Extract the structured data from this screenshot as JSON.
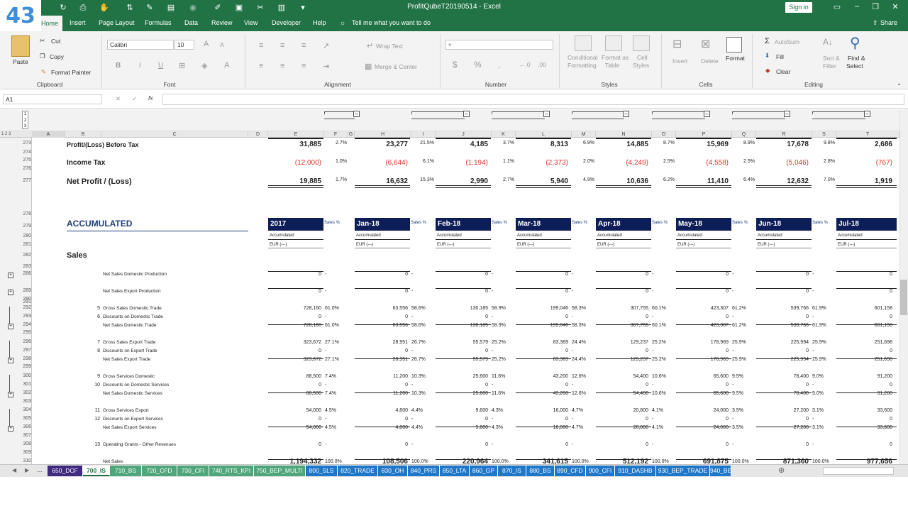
{
  "badge": "43",
  "title": "ProfitQubeT20190514  -  Excel",
  "signin": "Sign in",
  "ribbon_tabs": [
    "Home",
    "Insert",
    "Page Layout",
    "Formulas",
    "Data",
    "Review",
    "View",
    "Developer",
    "Help"
  ],
  "tellme": "Tell me what you want to do",
  "share": "Share",
  "clipboard": {
    "paste": "Paste",
    "cut": "Cut",
    "copy": "Copy",
    "format_painter": "Format Painter",
    "label": "Clipboard"
  },
  "font": {
    "name": "Calibri",
    "size": "10",
    "label": "Font",
    "b": "B",
    "i": "I",
    "u": "U"
  },
  "alignment": {
    "wrap": "Wrap Text",
    "merge": "Merge & Center",
    "label": "Alignment"
  },
  "number": {
    "label": "Number",
    "currency": "$",
    "percent": "%",
    "comma": ","
  },
  "styles": {
    "cond": "Conditional",
    "cond2": "Formatting",
    "fmt_as": "Format as",
    "fmt_as2": "Table",
    "cell": "Cell",
    "cell2": "Styles",
    "label": "Styles"
  },
  "cells": {
    "insert": "Insert",
    "delete": "Delete",
    "format": "Format",
    "label": "Cells"
  },
  "editing": {
    "autosum": "AutoSum",
    "fill": "Fill",
    "clear": "Clear",
    "sort": "Sort &",
    "sort2": "Filter",
    "find": "Find &",
    "find2": "Select",
    "label": "Editing"
  },
  "namebox": "A1",
  "fx": "fx",
  "col_letters": [
    "A",
    "B",
    "C",
    "D",
    "E",
    "F",
    "G",
    "H",
    "I",
    "J",
    "K",
    "L",
    "M",
    "N",
    "O",
    "P",
    "Q",
    "R",
    "S",
    "T"
  ],
  "outline_levels": [
    "1",
    "2",
    "3"
  ],
  "row_numbers": [
    "273",
    "274",
    "275",
    "276",
    "277",
    "278",
    "279",
    "280",
    "281",
    "282",
    "283",
    "286",
    "289",
    "290",
    "291",
    "292",
    "293",
    "294",
    "295",
    "296",
    "297",
    "298",
    "299",
    "300",
    "301",
    "302",
    "303",
    "304",
    "305",
    "306",
    "307",
    "308",
    "309",
    "310"
  ],
  "top_rows": {
    "pbt": {
      "label": "Profit/(Loss) Before Tax",
      "E": "31,885",
      "F": "2.7%",
      "H": "23,277",
      "I": "21.5%",
      "J": "4,185",
      "K": "3.7%",
      "L": "8,313",
      "M": "6.9%",
      "N": "14,885",
      "O": "8.7%",
      "P": "15,969",
      "Q": "8.9%",
      "R": "17,678",
      "S": "9.8%",
      "T": "2,686"
    },
    "tax": {
      "label": "Income Tax",
      "E": "(12,000)",
      "F": "1.0%",
      "H": "(6,644)",
      "I": "6.1%",
      "J": "(1,194)",
      "K": "1.1%",
      "L": "(2,373)",
      "M": "2.0%",
      "N": "(4,249)",
      "O": "2.5%",
      "P": "(4,558)",
      "Q": "2.5%",
      "R": "(5,046)",
      "S": "2.8%",
      "T": "(767)"
    },
    "np": {
      "label": "Net Profit / (Loss)",
      "E": "19,885",
      "F": "1.7%",
      "H": "16,632",
      "I": "15.3%",
      "J": "2,990",
      "K": "2.7%",
      "L": "5,940",
      "M": "4.9%",
      "N": "10,636",
      "O": "6.2%",
      "P": "11,410",
      "Q": "6.4%",
      "R": "12,632",
      "S": "7.0%",
      "T": "1,919"
    }
  },
  "section_title": "ACCUMULATED",
  "sales_title": "Sales",
  "months": [
    "2017",
    "Jan-18",
    "Feb-18",
    "Mar-18",
    "Apr-18",
    "May-18",
    "Jun-18",
    "Jul-18"
  ],
  "sales_pct": "Sales %",
  "accumulated": "Accumulated",
  "eur": "EUR (---)",
  "rows": [
    {
      "num": "",
      "label": "Net Sales Domestic Production",
      "v": [
        "0",
        "0",
        "0",
        "0",
        "0",
        "0",
        "0",
        "0"
      ],
      "p": [
        "-",
        "-",
        "-",
        "-",
        "-",
        "-",
        "-"
      ]
    },
    {
      "num": "",
      "label": "Net Sales Export Production",
      "v": [
        "0",
        "0",
        "0",
        "0",
        "0",
        "0",
        "0",
        "0"
      ],
      "p": [
        "-",
        "-",
        "-",
        "-",
        "-",
        "-",
        "-"
      ]
    },
    {
      "num": "5",
      "label": "Gross Sales Domestic Trade",
      "v": [
        "728,160",
        "63,556",
        "130,185",
        "199,046",
        "307,755",
        "423,307",
        "539,766",
        "601,158"
      ],
      "p": [
        "61.0%",
        "58.6%",
        "58.9%",
        "58.3%",
        "60.1%",
        "61.2%",
        "61.9%"
      ]
    },
    {
      "num": "6",
      "label": "Discounts on Domestic Trade",
      "v": [
        "0",
        "0",
        "0",
        "0",
        "0",
        "0",
        "0",
        "0"
      ],
      "p": [
        "-",
        "-",
        "-",
        "-",
        "-",
        "-",
        "-"
      ]
    },
    {
      "num": "",
      "label": "Net Sales Domestic Trade",
      "v": [
        "728,160",
        "63,556",
        "130,185",
        "199,046",
        "307,755",
        "423,307",
        "539,766",
        "601,158"
      ],
      "p": [
        "61.0%",
        "58.6%",
        "58.9%",
        "58.3%",
        "60.1%",
        "61.2%",
        "61.9%"
      ]
    },
    {
      "num": "7",
      "label": "Gross Sales Export Trade",
      "v": [
        "323,672",
        "28,951",
        "55,579",
        "83,369",
        "129,237",
        "178,969",
        "225,994",
        "251,698"
      ],
      "p": [
        "27.1%",
        "26.7%",
        "25.2%",
        "24.4%",
        "25.2%",
        "25.9%",
        "25.9%"
      ]
    },
    {
      "num": "8",
      "label": "Discounts on Export Trade",
      "v": [
        "0",
        "0",
        "0",
        "0",
        "0",
        "0",
        "0",
        "0"
      ],
      "p": [
        "-",
        "-",
        "-",
        "-",
        "-",
        "-",
        "-"
      ]
    },
    {
      "num": "",
      "label": "Net Sales Export Trade",
      "v": [
        "323,672",
        "28,951",
        "55,579",
        "83,369",
        "129,237",
        "178,969",
        "225,994",
        "251,698"
      ],
      "p": [
        "27.1%",
        "26.7%",
        "25.2%",
        "24.4%",
        "25.2%",
        "25.9%",
        "25.9%"
      ]
    },
    {
      "num": "9",
      "label": "Gross Services Domestic",
      "v": [
        "88,500",
        "11,200",
        "25,600",
        "43,200",
        "54,400",
        "65,600",
        "78,400",
        "91,200"
      ],
      "p": [
        "7.4%",
        "10.3%",
        "11.6%",
        "12.6%",
        "10.6%",
        "9.5%",
        "9.0%"
      ]
    },
    {
      "num": "10",
      "label": "Discounts on Domestic Services",
      "v": [
        "0",
        "0",
        "0",
        "0",
        "0",
        "0",
        "0",
        "0"
      ],
      "p": [
        "-",
        "-",
        "-",
        "-",
        "-",
        "-",
        "-"
      ]
    },
    {
      "num": "",
      "label": "Net Sales Domestic Services",
      "v": [
        "88,500",
        "11,200",
        "25,600",
        "43,200",
        "54,400",
        "65,600",
        "78,400",
        "91,200"
      ],
      "p": [
        "7.4%",
        "10.3%",
        "11.6%",
        "12.6%",
        "10.6%",
        "9.5%",
        "9.0%"
      ]
    },
    {
      "num": "11",
      "label": "Gross Services Export",
      "v": [
        "54,000",
        "4,800",
        "9,600",
        "16,000",
        "20,800",
        "24,000",
        "27,200",
        "33,600"
      ],
      "p": [
        "4.5%",
        "4.4%",
        "4.3%",
        "4.7%",
        "4.1%",
        "3.5%",
        "3.1%"
      ]
    },
    {
      "num": "12",
      "label": "Discounts on Export Services",
      "v": [
        "0",
        "0",
        "0",
        "0",
        "0",
        "0",
        "0",
        "0"
      ],
      "p": [
        "-",
        "-",
        "-",
        "-",
        "-",
        "-",
        "-"
      ]
    },
    {
      "num": "",
      "label": "Net Sales Export Services",
      "v": [
        "54,000",
        "4,800",
        "9,600",
        "16,000",
        "20,800",
        "24,000",
        "27,200",
        "33,600"
      ],
      "p": [
        "4.5%",
        "4.4%",
        "4.3%",
        "4.7%",
        "4.1%",
        "3.5%",
        "3.1%"
      ]
    },
    {
      "num": "13",
      "label": "Operating Grants - Other Revenues",
      "v": [
        "0",
        "0",
        "0",
        "0",
        "0",
        "0",
        "0",
        "0"
      ],
      "p": [
        "-",
        "-",
        "-",
        "-",
        "-",
        "-",
        "-"
      ]
    },
    {
      "num": "",
      "label": "Net Sales",
      "v": [
        "1,194,332",
        "108,506",
        "220,964",
        "341,615",
        "512,192",
        "691,875",
        "871,360",
        "977,656"
      ],
      "p": [
        "100.0%",
        "100.0%",
        "100.0%",
        "100.0%",
        "100.0%",
        "100.0%",
        "100.0%"
      ]
    }
  ],
  "sheet_tabs": [
    {
      "name": "650_DCF",
      "color": "#3f2a80"
    },
    {
      "name": "700_IS",
      "color": "#ffffff"
    },
    {
      "name": "710_BS",
      "color": "#4ea67a"
    },
    {
      "name": "720_CFD",
      "color": "#4ea67a"
    },
    {
      "name": "730_CFI",
      "color": "#4ea67a"
    },
    {
      "name": "740_RTS_KPI",
      "color": "#4ea67a"
    },
    {
      "name": "750_BEP_MULTI",
      "color": "#4ea67a"
    },
    {
      "name": "800_SLS",
      "color": "#1f77c9"
    },
    {
      "name": "820_TRADE",
      "color": "#1f77c9"
    },
    {
      "name": "830_OH",
      "color": "#1f77c9"
    },
    {
      "name": "840_PRS",
      "color": "#1f77c9"
    },
    {
      "name": "850_LTA",
      "color": "#1f77c9"
    },
    {
      "name": "860_GP",
      "color": "#1f77c9"
    },
    {
      "name": "870_IS",
      "color": "#1f77c9"
    },
    {
      "name": "880_BS",
      "color": "#1f77c9"
    },
    {
      "name": "890_CFD",
      "color": "#1f77c9"
    },
    {
      "name": "900_CFI",
      "color": "#1f77c9"
    },
    {
      "name": "910_DASHB",
      "color": "#1f77c9"
    },
    {
      "name": "930_BEP_TRADE",
      "color": "#1f77c9"
    },
    {
      "name": "940_BE",
      "color": "#1f77c9"
    }
  ],
  "sheet_more": "..."
}
